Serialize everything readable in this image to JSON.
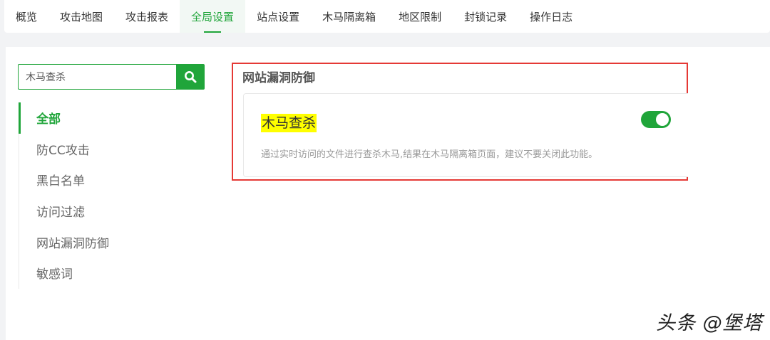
{
  "nav": {
    "tabs": [
      {
        "label": "概览"
      },
      {
        "label": "攻击地图"
      },
      {
        "label": "攻击报表"
      },
      {
        "label": "全局设置"
      },
      {
        "label": "站点设置"
      },
      {
        "label": "木马隔离箱"
      },
      {
        "label": "地区限制"
      },
      {
        "label": "封锁记录"
      },
      {
        "label": "操作日志"
      }
    ],
    "active_tab": "全局设置"
  },
  "search": {
    "value": "木马查杀",
    "icon": "search-icon"
  },
  "sidebar": {
    "items": [
      {
        "label": "全部"
      },
      {
        "label": "防CC攻击"
      },
      {
        "label": "黑白名单"
      },
      {
        "label": "访问过滤"
      },
      {
        "label": "网站漏洞防御"
      },
      {
        "label": "敏感词"
      }
    ],
    "active_item": "全部"
  },
  "section": {
    "title": "网站漏洞防御",
    "card": {
      "title": "木马查杀",
      "description": "通过实时访问的文件进行查杀木马,结果在木马隔离箱页面，建议不要关闭此功能。",
      "enabled": true
    }
  },
  "watermark": "头条 @堡塔",
  "colors": {
    "accent": "#20a53a",
    "highlight": "#ffff00",
    "annotation_border": "#e53935"
  }
}
